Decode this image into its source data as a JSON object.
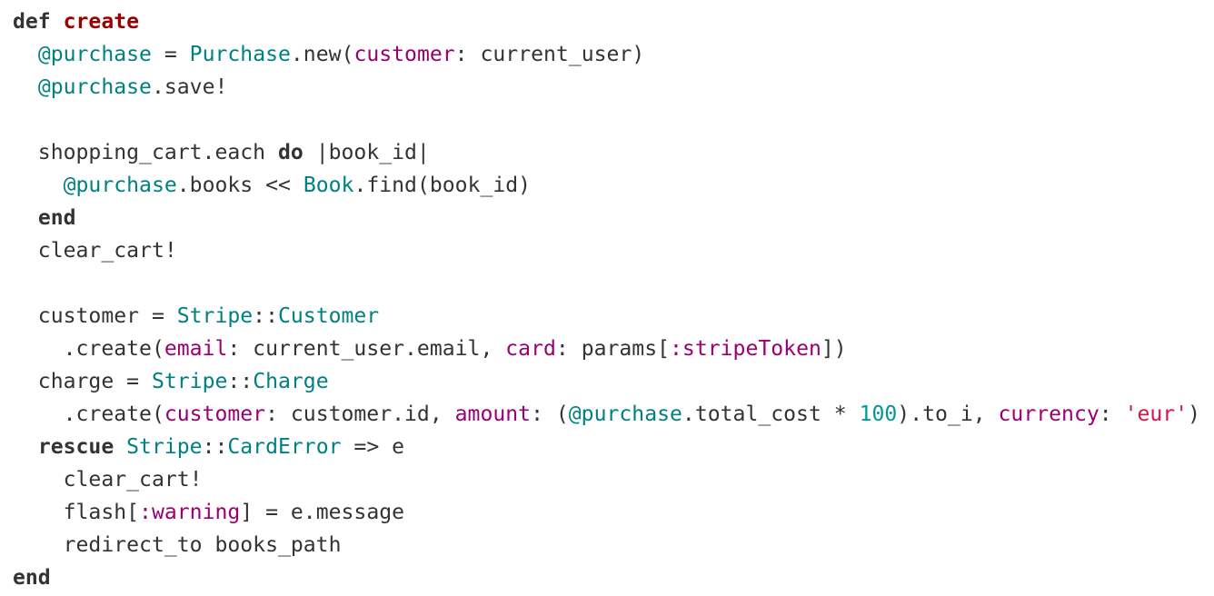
{
  "colors": {
    "keyword": "#333333",
    "function_name": "#990000",
    "instance_variable": "#008080",
    "constant": "#008080",
    "symbol": "#990073",
    "number": "#009999",
    "string": "#dd1144",
    "plain": "#333333",
    "background": "#ffffff"
  },
  "code_lines": [
    [
      [
        "kw",
        "def"
      ],
      [
        "p",
        " "
      ],
      [
        "fn",
        "create"
      ]
    ],
    [
      [
        "p",
        "  "
      ],
      [
        "ivar",
        "@purchase"
      ],
      [
        "p",
        " = "
      ],
      [
        "const",
        "Purchase"
      ],
      [
        "p",
        ".new("
      ],
      [
        "sym",
        "customer"
      ],
      [
        "p",
        ": current_user)"
      ]
    ],
    [
      [
        "p",
        "  "
      ],
      [
        "ivar",
        "@purchase"
      ],
      [
        "p",
        ".save!"
      ]
    ],
    [],
    [
      [
        "p",
        "  shopping_cart.each "
      ],
      [
        "kw",
        "do"
      ],
      [
        "p",
        " |book_id|"
      ]
    ],
    [
      [
        "p",
        "    "
      ],
      [
        "ivar",
        "@purchase"
      ],
      [
        "p",
        ".books << "
      ],
      [
        "const",
        "Book"
      ],
      [
        "p",
        ".find(book_id)"
      ]
    ],
    [
      [
        "p",
        "  "
      ],
      [
        "kw",
        "end"
      ]
    ],
    [
      [
        "p",
        "  clear_cart!"
      ]
    ],
    [],
    [
      [
        "p",
        "  customer = "
      ],
      [
        "const",
        "Stripe"
      ],
      [
        "p",
        "::"
      ],
      [
        "const",
        "Customer"
      ]
    ],
    [
      [
        "p",
        "    .create("
      ],
      [
        "sym",
        "email"
      ],
      [
        "p",
        ": current_user.email, "
      ],
      [
        "sym",
        "card"
      ],
      [
        "p",
        ": params["
      ],
      [
        "sym",
        ":stripeToken"
      ],
      [
        "p",
        "])"
      ]
    ],
    [
      [
        "p",
        "  charge = "
      ],
      [
        "const",
        "Stripe"
      ],
      [
        "p",
        "::"
      ],
      [
        "const",
        "Charge"
      ]
    ],
    [
      [
        "p",
        "    .create("
      ],
      [
        "sym",
        "customer"
      ],
      [
        "p",
        ": customer.id, "
      ],
      [
        "sym",
        "amount"
      ],
      [
        "p",
        ": ("
      ],
      [
        "ivar",
        "@purchase"
      ],
      [
        "p",
        ".total_cost * "
      ],
      [
        "num",
        "100"
      ],
      [
        "p",
        ").to_i, "
      ],
      [
        "sym",
        "currency"
      ],
      [
        "p",
        ": "
      ],
      [
        "str",
        "'eur'"
      ],
      [
        "p",
        ")"
      ]
    ],
    [
      [
        "p",
        "  "
      ],
      [
        "kw",
        "rescue"
      ],
      [
        "p",
        " "
      ],
      [
        "const",
        "Stripe"
      ],
      [
        "p",
        "::"
      ],
      [
        "const",
        "CardError"
      ],
      [
        "p",
        " => e"
      ]
    ],
    [
      [
        "p",
        "    clear_cart!"
      ]
    ],
    [
      [
        "p",
        "    flash["
      ],
      [
        "sym",
        ":warning"
      ],
      [
        "p",
        "] = e.message"
      ]
    ],
    [
      [
        "p",
        "    redirect_to books_path"
      ]
    ],
    [
      [
        "kw",
        "end"
      ]
    ]
  ]
}
